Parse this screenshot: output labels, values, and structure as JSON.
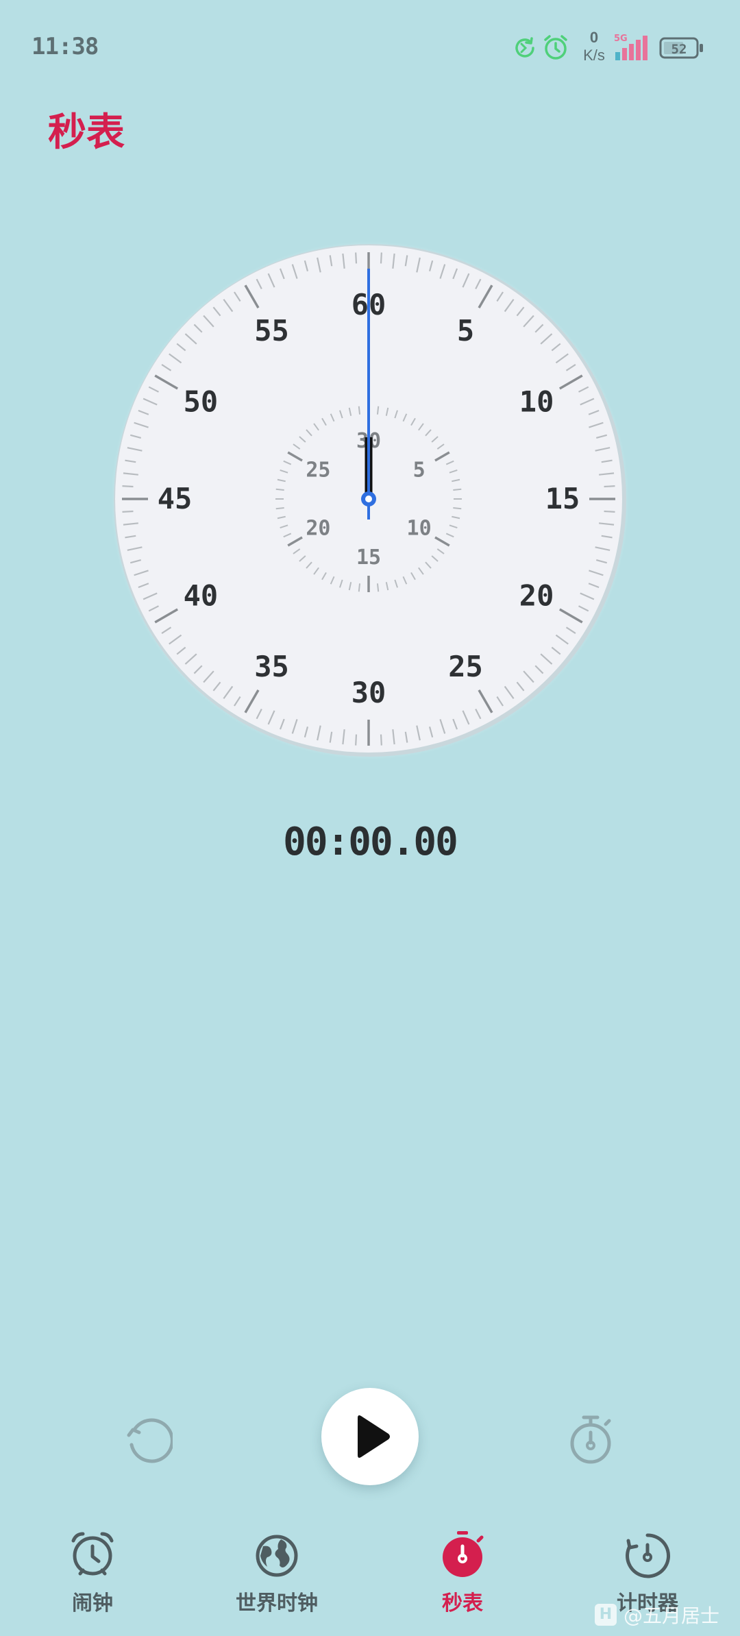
{
  "status_bar": {
    "time": "11:38",
    "net_speed_value": "0",
    "net_speed_unit": "K/s",
    "signal_label": "5G",
    "battery_level": "52",
    "icons": [
      "sync-icon",
      "alarm-status-icon",
      "signal-icon",
      "battery-icon"
    ]
  },
  "page": {
    "title": "秒表"
  },
  "dial": {
    "outer_labels": [
      "60",
      "5",
      "10",
      "15",
      "20",
      "25",
      "30",
      "35",
      "40",
      "45",
      "50",
      "55"
    ],
    "inner_labels": [
      "30",
      "5",
      "10",
      "15",
      "20",
      "25"
    ],
    "seconds_hand_value": 0,
    "minutes_hand_value": 0,
    "colors": {
      "face": "#f1f2f6",
      "rim": "#c9d7dc",
      "seconds_hand": "#2f6fe0",
      "minutes_hand": "#111111",
      "tick_major": "#8a8e92",
      "tick_minor": "#b8bcc0",
      "label": "#2e3134",
      "inner_label": "#7d8185"
    }
  },
  "elapsed": {
    "value": "00:00.00"
  },
  "controls": {
    "reset_icon": "reset-icon",
    "start_icon": "play-icon",
    "lap_icon": "lap-icon"
  },
  "nav": {
    "items": [
      {
        "label": "闹钟",
        "icon": "alarm-clock-icon",
        "active": false
      },
      {
        "label": "世界时钟",
        "icon": "globe-icon",
        "active": false
      },
      {
        "label": "秒表",
        "icon": "stopwatch-icon",
        "active": true
      },
      {
        "label": "计时器",
        "icon": "timer-icon",
        "active": false
      }
    ],
    "active_color": "#d41f4e",
    "inactive_color": "#4f5d61"
  },
  "watermark": {
    "logo": "H",
    "text": "@五月居士"
  },
  "colors": {
    "background": "#b7dfe4",
    "accent": "#d41f4e"
  }
}
